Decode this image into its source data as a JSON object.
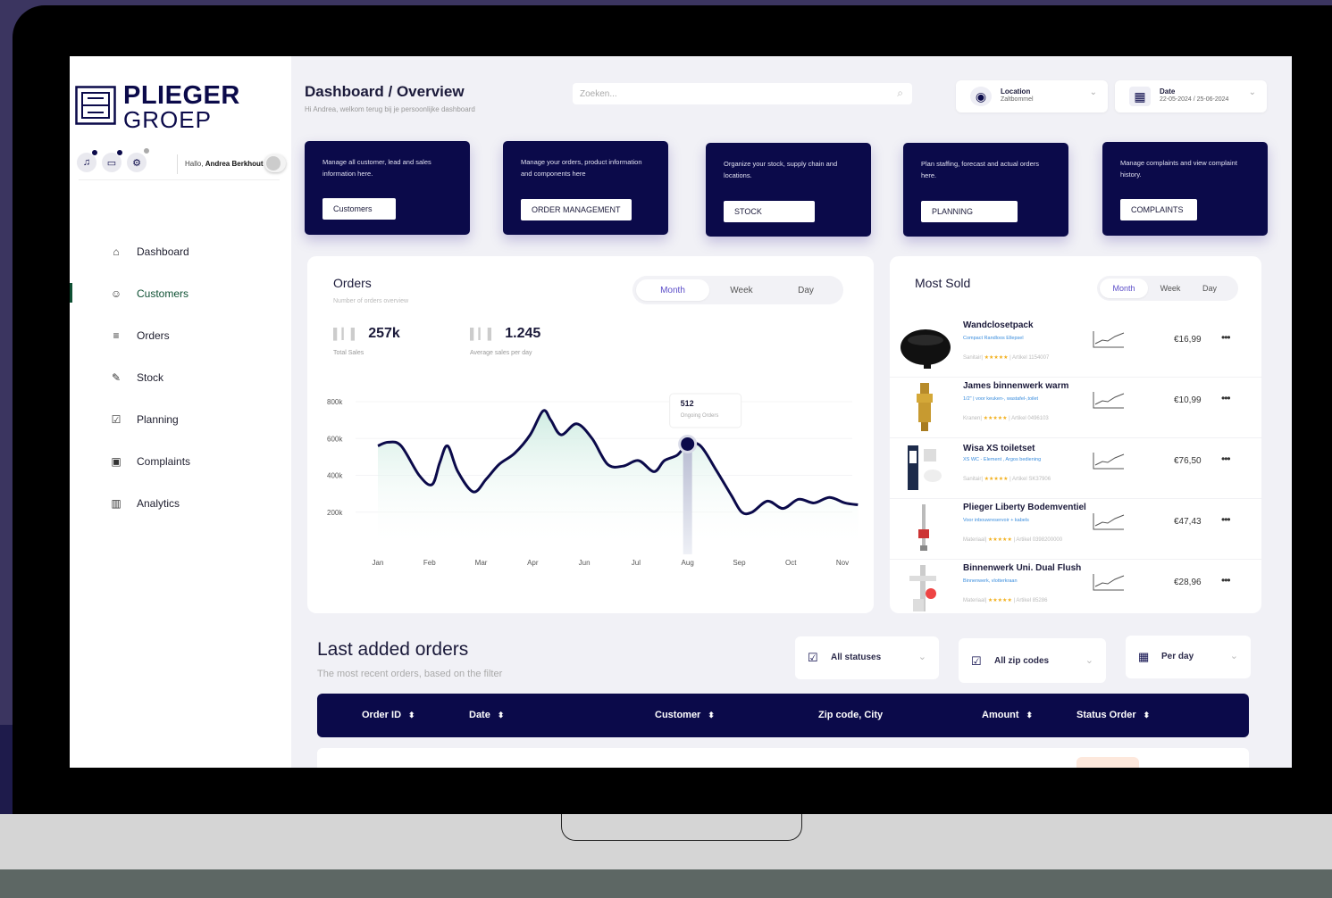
{
  "brand": {
    "line1": "PLIEGER",
    "line2": "GROEP"
  },
  "user": {
    "greeting": "Hallo,",
    "name": "Andrea Berkhout"
  },
  "header": {
    "title": "Dashboard / Overview",
    "subtitle": "Hi Andrea, welkom terug bij je persoonlijke dashboard",
    "search_placeholder": "Zoeken...",
    "location": {
      "label": "Location",
      "value": "Zaltbommel"
    },
    "date": {
      "label": "Date",
      "value": "22-05-2024 / 25-06-2024"
    }
  },
  "nav": [
    {
      "label": "Dashboard",
      "icon": "home-icon",
      "glyph": "⌂"
    },
    {
      "label": "Customers",
      "icon": "user-icon",
      "glyph": "☺"
    },
    {
      "label": "Orders",
      "icon": "list-icon",
      "glyph": "≡"
    },
    {
      "label": "Stock",
      "icon": "pencil-icon",
      "glyph": "✎"
    },
    {
      "label": "Planning",
      "icon": "edit-box-icon",
      "glyph": "☑"
    },
    {
      "label": "Complaints",
      "icon": "calendar-icon",
      "glyph": "▣"
    },
    {
      "label": "Analytics",
      "icon": "bar-chart-icon",
      "glyph": "▥"
    }
  ],
  "nav_active": "Customers",
  "cards": [
    {
      "text": "Manage all customer, lead and sales information here.",
      "button": "Customers"
    },
    {
      "text": "Manage your orders, product information and components here",
      "button": "ORDER MANAGEMENT"
    },
    {
      "text": "Organize your stock, supply chain and locations.",
      "button": "STOCK"
    },
    {
      "text": "Plan staffing, forecast and actual orders here.",
      "button": "PLANNING"
    },
    {
      "text": "Manage complaints and view complaint history.",
      "button": "COMPLAINTS"
    }
  ],
  "orders": {
    "title": "Orders",
    "subtitle": "Number of orders overview",
    "tabs": [
      "Month",
      "Week",
      "Day"
    ],
    "active_tab": "Month",
    "kpis": [
      {
        "value": "257k",
        "label": "Total Sales"
      },
      {
        "value": "1.245",
        "label": "Average sales per day"
      }
    ],
    "tooltip": {
      "value": "512",
      "label": "Ongoing Orders"
    }
  },
  "chart_data": {
    "type": "area",
    "categories": [
      "Jan",
      "Feb",
      "Mar",
      "Apr",
      "Jun",
      "Jul",
      "Aug",
      "Sep",
      "Oct",
      "Nov"
    ],
    "ytick_labels": [
      "800k",
      "600k",
      "400k",
      "200k"
    ],
    "ylim": [
      0,
      800000
    ],
    "x": [
      0,
      0.2,
      0.45,
      0.8,
      1.05,
      1.2,
      1.35,
      1.55,
      1.85,
      2.1,
      2.35,
      2.65,
      2.95,
      3.2,
      3.35,
      3.55,
      3.85,
      4.15,
      4.45,
      4.75,
      5.05,
      5.35,
      5.55,
      5.8,
      6.0,
      6.25,
      6.55,
      6.85,
      7.05,
      7.25,
      7.55,
      7.85,
      8.15,
      8.45,
      8.75,
      9.05,
      9.3
    ],
    "values": [
      560000,
      580000,
      560000,
      400000,
      350000,
      470000,
      560000,
      420000,
      310000,
      380000,
      460000,
      520000,
      620000,
      750000,
      700000,
      620000,
      680000,
      600000,
      460000,
      450000,
      480000,
      420000,
      480000,
      510000,
      570000,
      560000,
      430000,
      290000,
      200000,
      200000,
      260000,
      220000,
      270000,
      250000,
      280000,
      250000,
      240000
    ],
    "highlight": {
      "category": "Aug",
      "value": 512
    }
  },
  "most_sold": {
    "title": "Most Sold",
    "tabs": [
      "Month",
      "Week",
      "Day"
    ],
    "active_tab": "Month",
    "items": [
      {
        "name": "Wandclosetpack",
        "desc": "Compact Randloos Ellepsel",
        "category": "Sanitair",
        "article": "Artikel 1154007",
        "price": "€16,99"
      },
      {
        "name": "James binnenwerk warm",
        "desc": "1/2\" | voor keuken-, wastafel-,toilet",
        "category": "Kranen",
        "article": "Artikel 0496103",
        "price": "€10,99"
      },
      {
        "name": "Wisa XS toiletset",
        "desc": "XS WC - Element , Argos bediening",
        "category": "Sanitair",
        "article": "Artikel SK37906",
        "price": "€76,50"
      },
      {
        "name": "Plieger Liberty Bodemventiel",
        "desc": "Voor inbouwreservoir + kabels",
        "category": "Materiaal",
        "article": "Artikel 0398200000",
        "price": "€47,43"
      },
      {
        "name": "Binnenwerk Uni. Dual Flush",
        "desc": "Binnenwerk, vlotterkraan",
        "category": "Materiaal",
        "article": "Artikel 85286",
        "price": "€28,96"
      }
    ]
  },
  "last_orders": {
    "title": "Last added orders",
    "subtitle": "The most recent orders, based on the filter",
    "filters": [
      "All statuses",
      "All zip codes",
      "Per day"
    ],
    "columns": [
      "Order ID",
      "Date",
      "Customer",
      "Zip code, City",
      "Amount",
      "Status Order"
    ]
  }
}
